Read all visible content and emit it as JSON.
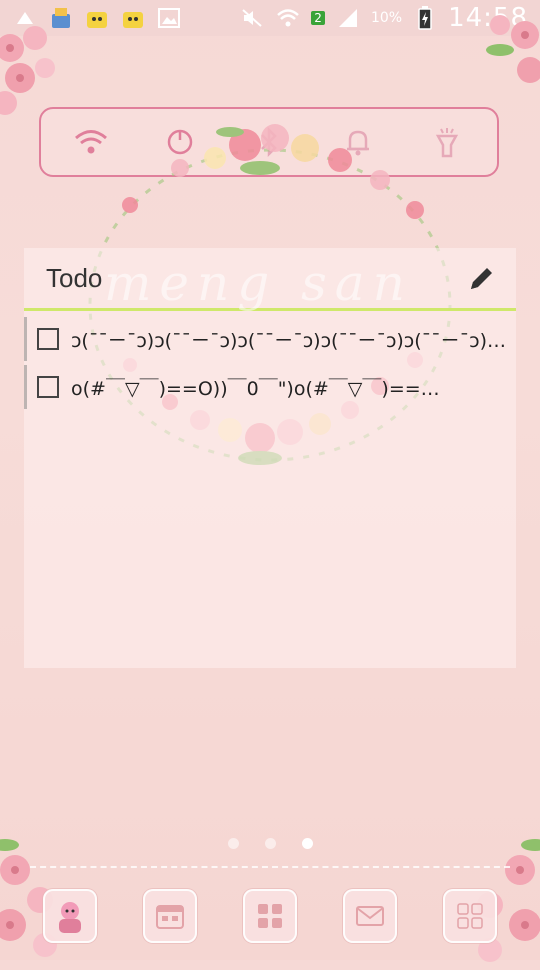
{
  "status_bar": {
    "network_badge": "2",
    "battery_percent": "10%",
    "time": "14:58"
  },
  "quick_toggles": [
    {
      "icon": "wifi-icon"
    },
    {
      "icon": "brightness-icon"
    },
    {
      "icon": "bluetooth-icon"
    },
    {
      "icon": "bell-icon"
    },
    {
      "icon": "flashlight-icon"
    }
  ],
  "todo_widget": {
    "title": "Todo",
    "watermark": "meng san",
    "items": [
      {
        "text": "ↄ(¯¯ㄧ¯ↄ)ↄ(¯¯ㄧ¯ↄ)ↄ(¯¯ㄧ¯ↄ)ↄ(¯¯ㄧ¯ↄ)ↄ(¯¯ㄧ¯ↄ)ↄ(…",
        "checked": false
      },
      {
        "text": "o(#￣▽￣)==O))￣0￣\")o(#￣▽￣)==…",
        "checked": false
      }
    ]
  },
  "page_indicator": {
    "count": 3,
    "active": 2
  },
  "dock": [
    {
      "icon": "avatar-app-icon"
    },
    {
      "icon": "calendar-app-icon"
    },
    {
      "icon": "app-drawer-icon"
    },
    {
      "icon": "mail-app-icon"
    },
    {
      "icon": "calculator-app-icon"
    }
  ],
  "colors": {
    "accent_pink": "#e07f9b",
    "header_underline": "#cfe86a",
    "background": "#f6d9d6"
  }
}
